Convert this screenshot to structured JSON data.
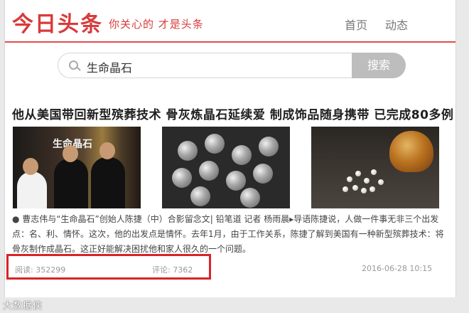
{
  "header": {
    "logo": "今日头条",
    "slogan": "你关心的 才是头条",
    "nav": [
      "首页",
      "动态"
    ]
  },
  "search": {
    "query": "生命晶石",
    "button": "搜索"
  },
  "article": {
    "title": "他从美国带回新型殡葬技术 骨灰炼晶石延续爱 制成饰品随身携带 已完成80多例",
    "image1_text": "生命晶石",
    "body": "● 曹志伟与“生命晶石”创始人陈捷（中）合影留念文| 铅笔道 记者 杨雨晨▸导语陈捷说，人做一件事无非三个出发点：名、利、情怀。这次，他的出发点是情怀。去年1月，由于工作关系，陈捷了解到美国有一种新型殡葬技术：将骨灰制作成晶石。这正好能解决困扰他和家人很久的一个问题。",
    "reads": "阅读: 352299",
    "comments": "评论: 7362",
    "date": "2016-06-28 10:15"
  },
  "watermark": "大数据侠"
}
